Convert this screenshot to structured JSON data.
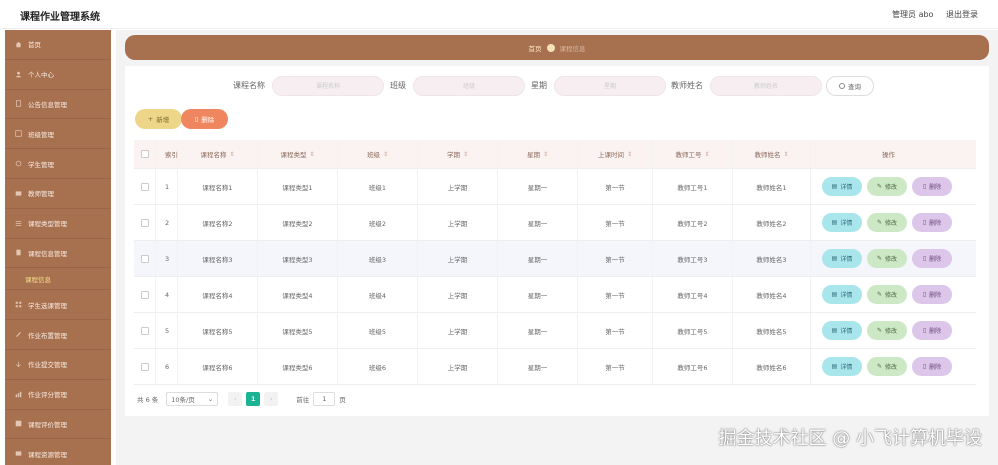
{
  "app": {
    "title": "课程作业管理系统",
    "user_label": "管理员 abo",
    "logout_label": "退出登录"
  },
  "sidebar": {
    "items": [
      {
        "label": "首页",
        "icon": "home-icon"
      },
      {
        "label": "个人中心",
        "icon": "user-icon"
      },
      {
        "label": "公告信息管理",
        "icon": "notice-icon"
      },
      {
        "label": "班级管理",
        "icon": "grid-icon"
      },
      {
        "label": "学生管理",
        "icon": "student-icon"
      },
      {
        "label": "教师管理",
        "icon": "teacher-icon"
      },
      {
        "label": "课程类型管理",
        "icon": "list-icon"
      },
      {
        "label": "课程信息管理",
        "icon": "book-icon"
      }
    ],
    "active_sub": "课程信息",
    "items_after": [
      {
        "label": "学生选课管理",
        "icon": "select-icon"
      },
      {
        "label": "作业布置管理",
        "icon": "assign-icon"
      },
      {
        "label": "作业提交管理",
        "icon": "submit-icon"
      },
      {
        "label": "作业评分管理",
        "icon": "score-icon"
      },
      {
        "label": "课程评价管理",
        "icon": "rate-icon"
      },
      {
        "label": "课程资源管理",
        "icon": "resource-icon"
      }
    ]
  },
  "breadcrumb": {
    "home": "首页",
    "current": "课程信息"
  },
  "search": {
    "course_name_label": "课程名称",
    "course_name_placeholder": "课程名称",
    "class_label": "班级",
    "class_placeholder": "班级",
    "week_label": "星期",
    "week_placeholder": "星期",
    "teacher_label": "教师姓名",
    "teacher_placeholder": "教师姓名",
    "query_label": "查询"
  },
  "actions": {
    "add_label": "新增",
    "delete_label": "删除"
  },
  "table": {
    "headers": {
      "index": "索引",
      "course_name": "课程名称",
      "course_type": "课程类型",
      "class": "班级",
      "term": "学期",
      "weekday": "星期",
      "time": "上课时间",
      "teacher_no": "教师工号",
      "teacher_name": "教师姓名",
      "ops": "操作"
    },
    "rows": [
      {
        "index": "1",
        "course_name": "课程名称1",
        "course_type": "课程类型1",
        "class": "班级1",
        "term": "上学期",
        "weekday": "星期一",
        "time": "第一节",
        "teacher_no": "教师工号1",
        "teacher_name": "教师姓名1"
      },
      {
        "index": "2",
        "course_name": "课程名称2",
        "course_type": "课程类型2",
        "class": "班级2",
        "term": "上学期",
        "weekday": "星期一",
        "time": "第一节",
        "teacher_no": "教师工号2",
        "teacher_name": "教师姓名2"
      },
      {
        "index": "3",
        "course_name": "课程名称3",
        "course_type": "课程类型3",
        "class": "班级3",
        "term": "上学期",
        "weekday": "星期一",
        "time": "第一节",
        "teacher_no": "教师工号3",
        "teacher_name": "教师姓名3"
      },
      {
        "index": "4",
        "course_name": "课程名称4",
        "course_type": "课程类型4",
        "class": "班级4",
        "term": "上学期",
        "weekday": "星期一",
        "time": "第一节",
        "teacher_no": "教师工号4",
        "teacher_name": "教师姓名4"
      },
      {
        "index": "5",
        "course_name": "课程名称5",
        "course_type": "课程类型5",
        "class": "班级5",
        "term": "上学期",
        "weekday": "星期一",
        "time": "第一节",
        "teacher_no": "教师工号5",
        "teacher_name": "教师姓名5"
      },
      {
        "index": "6",
        "course_name": "课程名称6",
        "course_type": "课程类型6",
        "class": "班级6",
        "term": "上学期",
        "weekday": "星期一",
        "time": "第一节",
        "teacher_no": "教师工号6",
        "teacher_name": "教师姓名6"
      }
    ],
    "op_detail": "详情",
    "op_edit": "修改",
    "op_delete": "删除"
  },
  "pager": {
    "total": "共 6 条",
    "page_size": "10条/页",
    "current_page": "1",
    "goto_label": "前往",
    "goto_value": "1",
    "page_suffix": "页"
  },
  "watermark": "掘金技术社区 @ 小飞计算机毕设",
  "colors": {
    "sidebar_bg": "#a7704f",
    "accent_green": "#1ab394",
    "add_btn": "#eed689",
    "delete_btn": "#f0865f"
  }
}
